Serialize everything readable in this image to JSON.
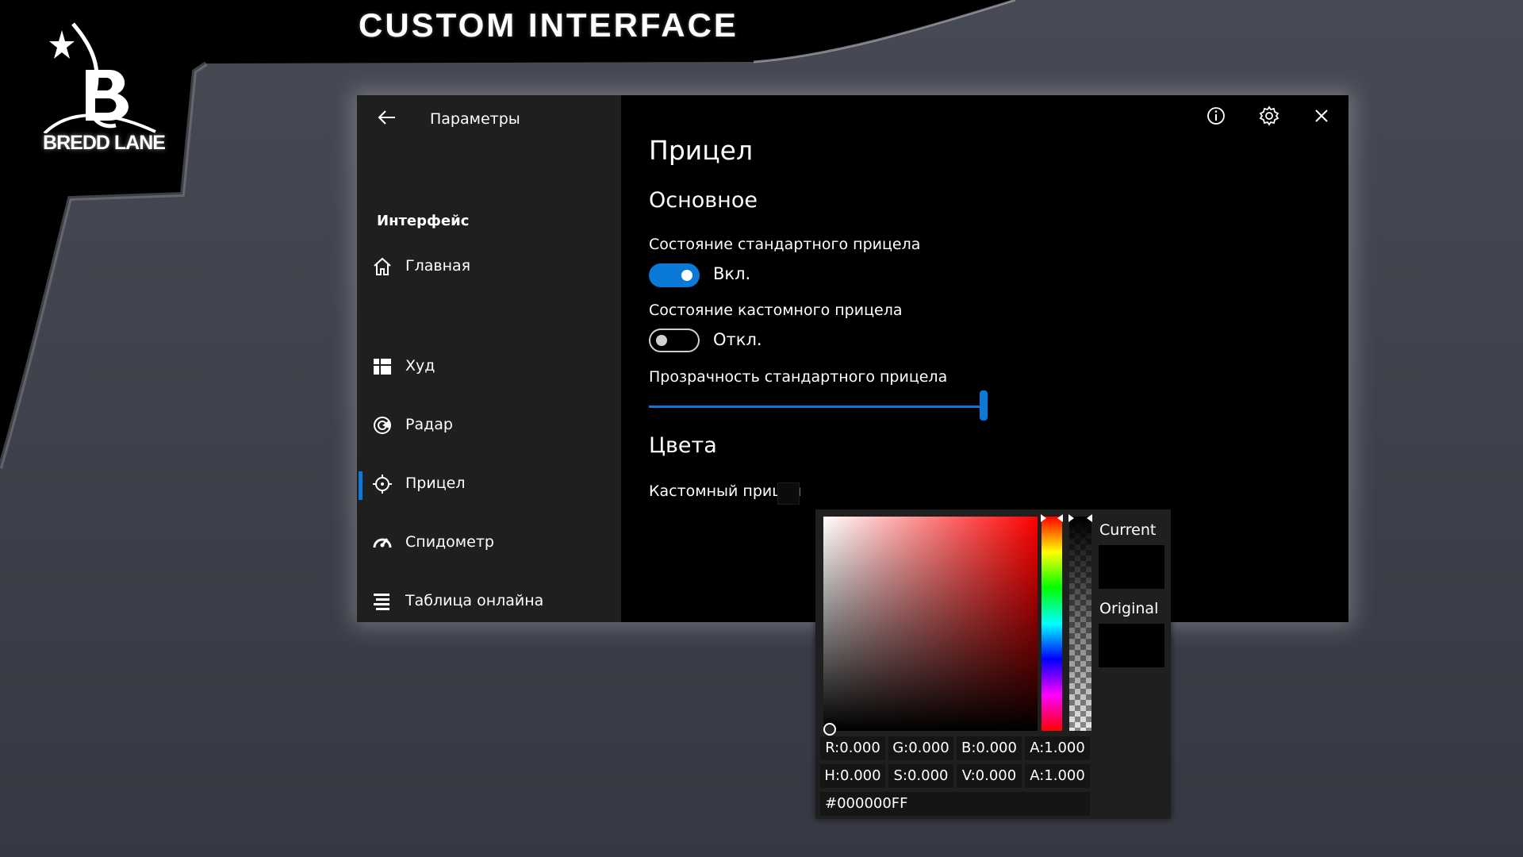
{
  "brand": {
    "logo_text": "BREDD LANE",
    "banner_title": "CUSTOM INTERFACE"
  },
  "window": {
    "header": {
      "back_icon": "arrow-left-icon",
      "title": "Параметры"
    },
    "top_icons": [
      "info-icon",
      "gear-icon",
      "close-icon"
    ],
    "sidebar": {
      "section_header": "Интерфейс",
      "items": [
        {
          "label": "Главная",
          "icon": "home-icon",
          "active": false
        },
        {
          "label": "Худ",
          "icon": "dashboard-icon",
          "active": false
        },
        {
          "label": "Радар",
          "icon": "radar-icon",
          "active": false
        },
        {
          "label": "Прицел",
          "icon": "crosshair-icon",
          "active": true
        },
        {
          "label": "Спидометр",
          "icon": "speedometer-icon",
          "active": false
        },
        {
          "label": "Таблица онлайна",
          "icon": "list-icon",
          "active": false
        }
      ]
    },
    "content": {
      "page_title": "Прицел",
      "section_main": "Основное",
      "settings": {
        "standard_crosshair": {
          "label": "Состояние стандартного прицела",
          "state": "Вкл.",
          "enabled": true
        },
        "custom_crosshair": {
          "label": "Состояние кастомного прицела",
          "state": "Откл.",
          "enabled": false
        },
        "opacity": {
          "label": "Прозрачность стандартного прицела",
          "value": 1.0
        }
      },
      "section_colors": "Цвета",
      "color_setting": {
        "label": "Кастомный прицел",
        "color": "#000000"
      }
    }
  },
  "color_picker": {
    "current_label": "Current",
    "original_label": "Original",
    "current_color": "#000000",
    "original_color": "#000000",
    "hue_base_color": "#ff0000",
    "rgba": [
      "R:0.000",
      "G:0.000",
      "B:0.000",
      "A:1.000"
    ],
    "hsva": [
      "H:0.000",
      "S:0.000",
      "V:0.000",
      "A:1.000"
    ],
    "hex": "#000000FF"
  },
  "colors": {
    "accent": "#0a79d8",
    "sidebar_bg": "#1f1f1f",
    "content_bg": "#000000"
  }
}
